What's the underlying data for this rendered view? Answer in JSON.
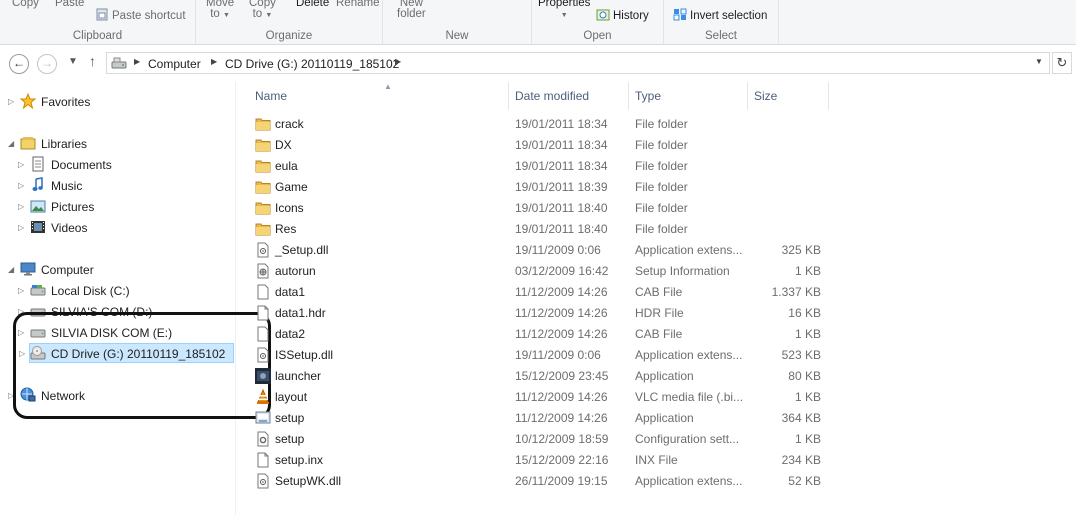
{
  "ribbon": {
    "copy": "Copy",
    "paste": "Paste",
    "paste_shortcut": "Paste shortcut",
    "clipboard_group": "Clipboard",
    "move_to": "Move",
    "move_to_2": "to",
    "copy_to": "Copy",
    "copy_to_2": "to",
    "delete": "Delete",
    "rename": "Rename",
    "organize_group": "Organize",
    "new_folder": "New",
    "new_folder_2": "folder",
    "new_group": "New",
    "properties": "Properties",
    "history": "History",
    "open_group": "Open",
    "invert_selection": "Invert selection",
    "select_group": "Select"
  },
  "address": {
    "crumbs": [
      "Computer",
      "CD Drive (G:) 20110119_185102"
    ]
  },
  "nav": {
    "favorites": "Favorites",
    "libraries": "Libraries",
    "documents": "Documents",
    "music": "Music",
    "pictures": "Pictures",
    "videos": "Videos",
    "computer": "Computer",
    "local_disk": "Local Disk (C:)",
    "silvia_d": "SILVIA'S COM (D:)",
    "silvia_e": "SILVIA DISK COM (E:)",
    "cd_drive": "CD Drive (G:) 20110119_185102",
    "network": "Network"
  },
  "columns": {
    "name": "Name",
    "date": "Date modified",
    "type": "Type",
    "size": "Size"
  },
  "files": [
    {
      "name": "crack",
      "date": "19/01/2011 18:34",
      "type": "File folder",
      "size": "",
      "icon": "folder-icon"
    },
    {
      "name": "DX",
      "date": "19/01/2011 18:34",
      "type": "File folder",
      "size": "",
      "icon": "folder-icon"
    },
    {
      "name": "eula",
      "date": "19/01/2011 18:34",
      "type": "File folder",
      "size": "",
      "icon": "folder-icon"
    },
    {
      "name": "Game",
      "date": "19/01/2011 18:39",
      "type": "File folder",
      "size": "",
      "icon": "folder-icon"
    },
    {
      "name": "Icons",
      "date": "19/01/2011 18:40",
      "type": "File folder",
      "size": "",
      "icon": "folder-icon"
    },
    {
      "name": "Res",
      "date": "19/01/2011 18:40",
      "type": "File folder",
      "size": "",
      "icon": "folder-icon"
    },
    {
      "name": "_Setup.dll",
      "date": "19/11/2009 0:06",
      "type": "Application extens...",
      "size": "325 KB",
      "icon": "dll-icon"
    },
    {
      "name": "autorun",
      "date": "03/12/2009 16:42",
      "type": "Setup Information",
      "size": "1 KB",
      "icon": "setup-info-icon"
    },
    {
      "name": "data1",
      "date": "11/12/2009 14:26",
      "type": "CAB File",
      "size": "1.337 KB",
      "icon": "cab-file-icon"
    },
    {
      "name": "data1.hdr",
      "date": "11/12/2009 14:26",
      "type": "HDR File",
      "size": "16 KB",
      "icon": "file-icon"
    },
    {
      "name": "data2",
      "date": "11/12/2009 14:26",
      "type": "CAB File",
      "size": "1 KB",
      "icon": "cab-file-icon"
    },
    {
      "name": "ISSetup.dll",
      "date": "19/11/2009 0:06",
      "type": "Application extens...",
      "size": "523 KB",
      "icon": "dll-icon"
    },
    {
      "name": "launcher",
      "date": "15/12/2009 23:45",
      "type": "Application",
      "size": "80 KB",
      "icon": "launcher-app-icon"
    },
    {
      "name": "layout",
      "date": "11/12/2009 14:26",
      "type": "VLC media file (.bi...",
      "size": "1 KB",
      "icon": "vlc-cone-icon"
    },
    {
      "name": "setup",
      "date": "11/12/2009 14:26",
      "type": "Application",
      "size": "364 KB",
      "icon": "setup-app-icon"
    },
    {
      "name": "setup",
      "date": "10/12/2009 18:59",
      "type": "Configuration sett...",
      "size": "1 KB",
      "icon": "config-file-icon"
    },
    {
      "name": "setup.inx",
      "date": "15/12/2009 22:16",
      "type": "INX File",
      "size": "234 KB",
      "icon": "file-icon"
    },
    {
      "name": "SetupWK.dll",
      "date": "26/11/2009 19:15",
      "type": "Application extens...",
      "size": "52 KB",
      "icon": "dll-icon"
    }
  ]
}
